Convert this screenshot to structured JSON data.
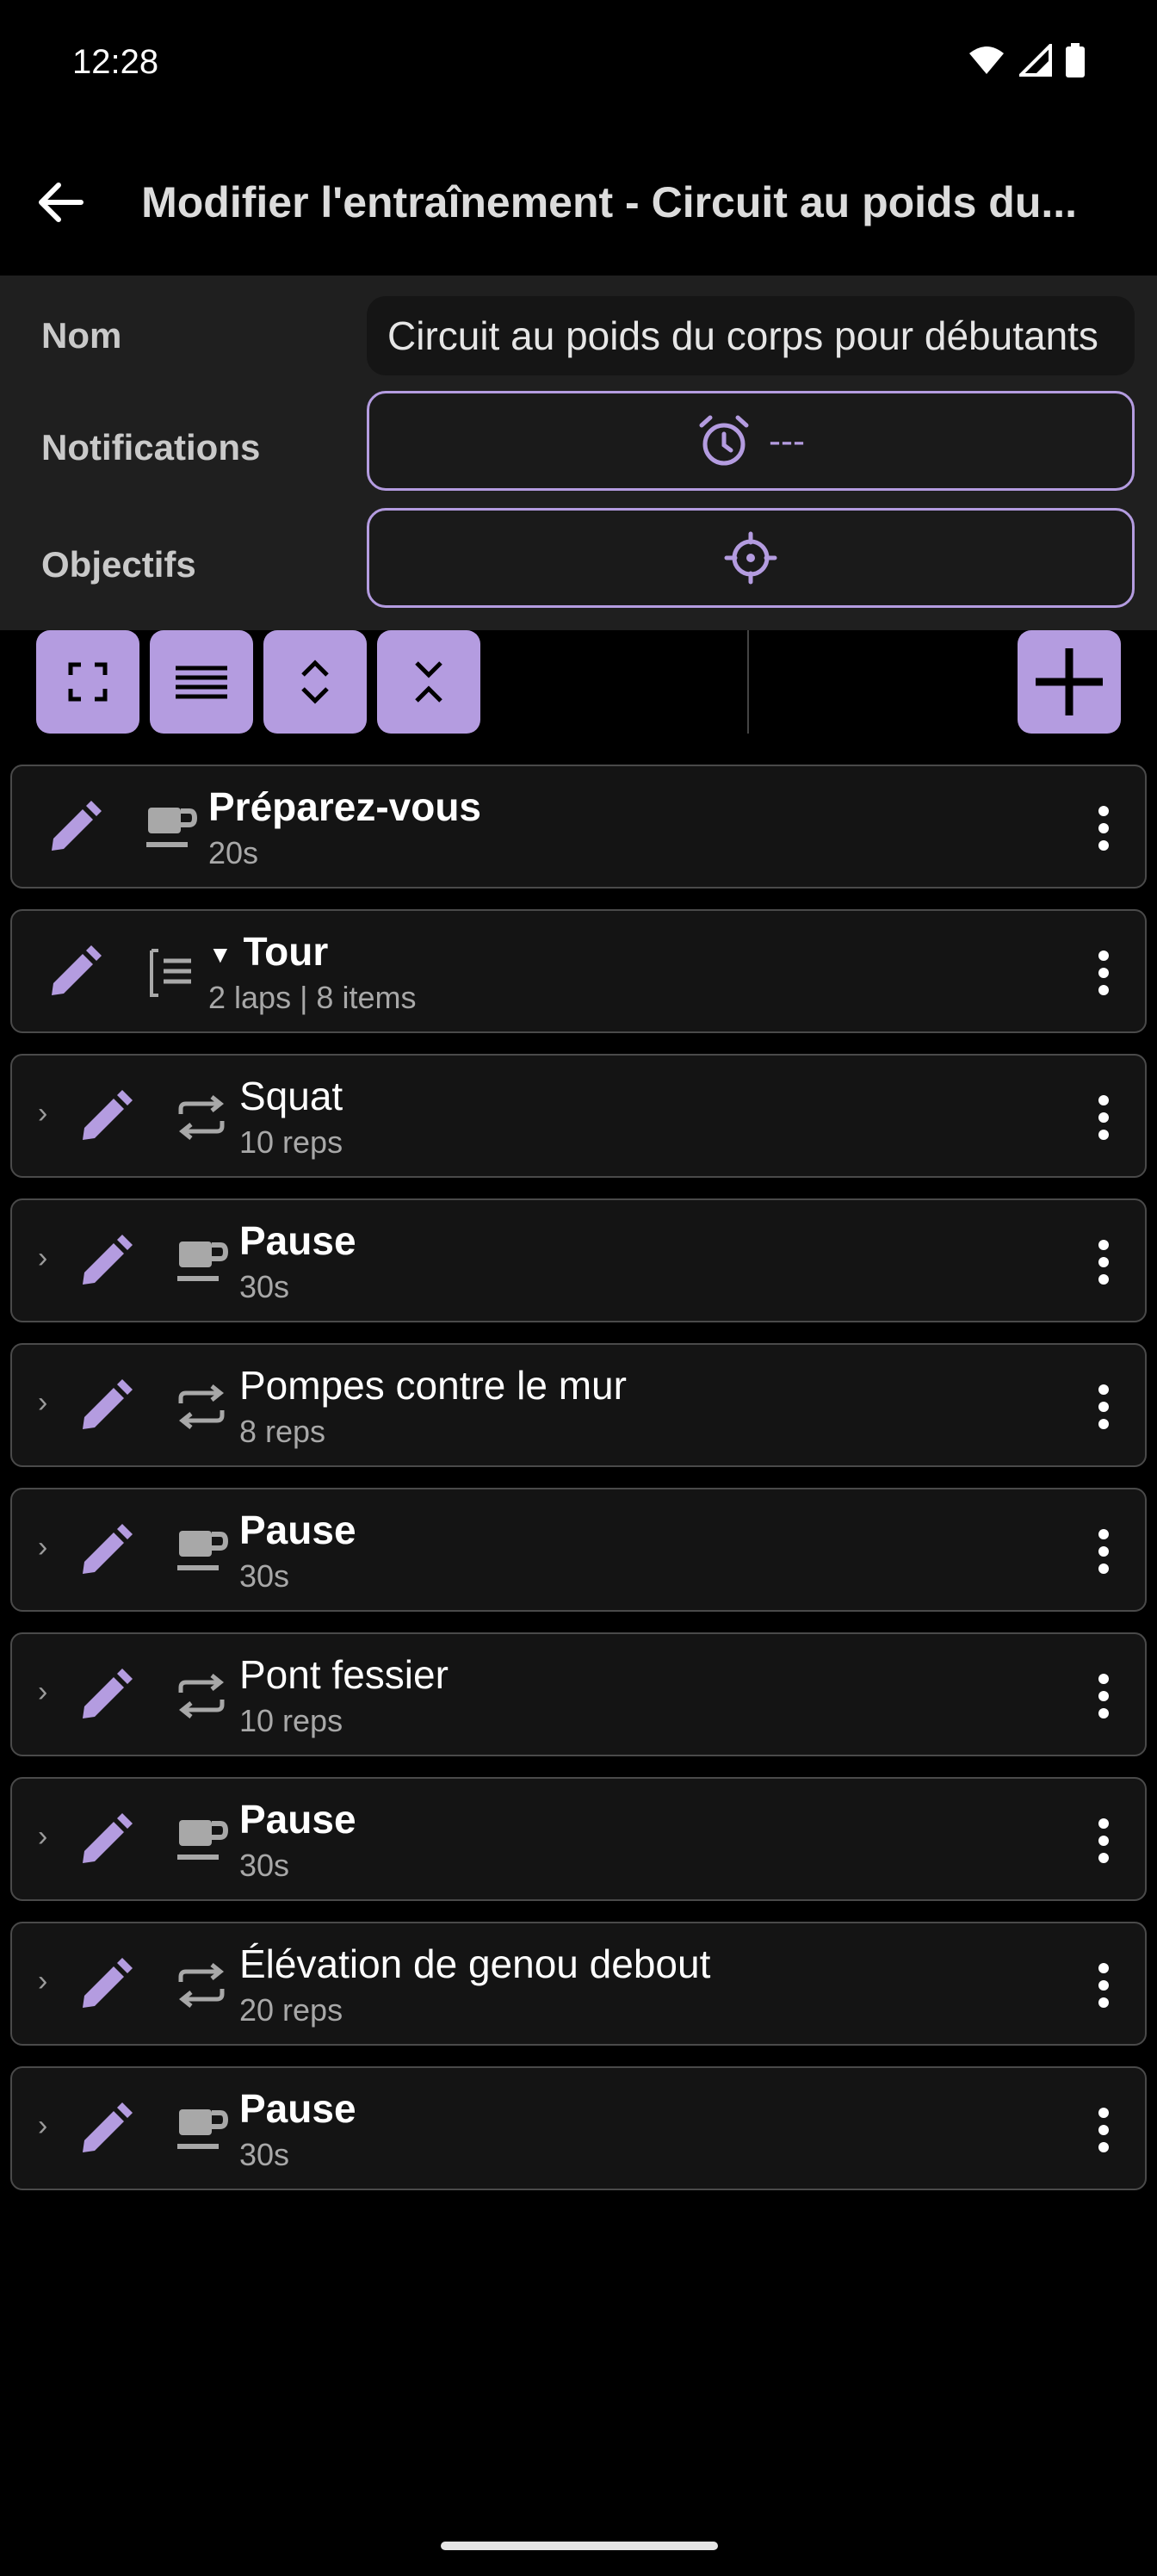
{
  "status_bar": {
    "time": "12:28"
  },
  "app_bar": {
    "title": "Modifier l'entraînement - Circuit au poids du..."
  },
  "form": {
    "name_label": "Nom",
    "name_value": "Circuit au poids du corps pour débutants",
    "notifications_label": "Notifications",
    "notifications_value": "---",
    "objectives_label": "Objectifs"
  },
  "items": [
    {
      "title": "Préparez-vous",
      "subtitle": "20s",
      "type": "rest",
      "bold": true,
      "nested": false
    },
    {
      "title": "Tour",
      "subtitle": "2 laps | 8 items",
      "type": "round",
      "bold": true,
      "nested": false
    },
    {
      "title": "Squat",
      "subtitle": "10 reps",
      "type": "reps",
      "bold": false,
      "nested": true
    },
    {
      "title": "Pause",
      "subtitle": "30s",
      "type": "rest",
      "bold": true,
      "nested": true
    },
    {
      "title": "Pompes contre le mur",
      "subtitle": "8 reps",
      "type": "reps",
      "bold": false,
      "nested": true
    },
    {
      "title": "Pause",
      "subtitle": "30s",
      "type": "rest",
      "bold": true,
      "nested": true
    },
    {
      "title": "Pont fessier",
      "subtitle": "10 reps",
      "type": "reps",
      "bold": false,
      "nested": true
    },
    {
      "title": "Pause",
      "subtitle": "30s",
      "type": "rest",
      "bold": true,
      "nested": true
    },
    {
      "title": "Élévation de genou debout",
      "subtitle": "20 reps",
      "type": "reps",
      "bold": false,
      "nested": true
    },
    {
      "title": "Pause",
      "subtitle": "30s",
      "type": "rest",
      "bold": true,
      "nested": true
    }
  ],
  "colors": {
    "accent": "#b49ce0",
    "background": "#000000",
    "panel": "#1f1f1f",
    "card": "#141414"
  }
}
